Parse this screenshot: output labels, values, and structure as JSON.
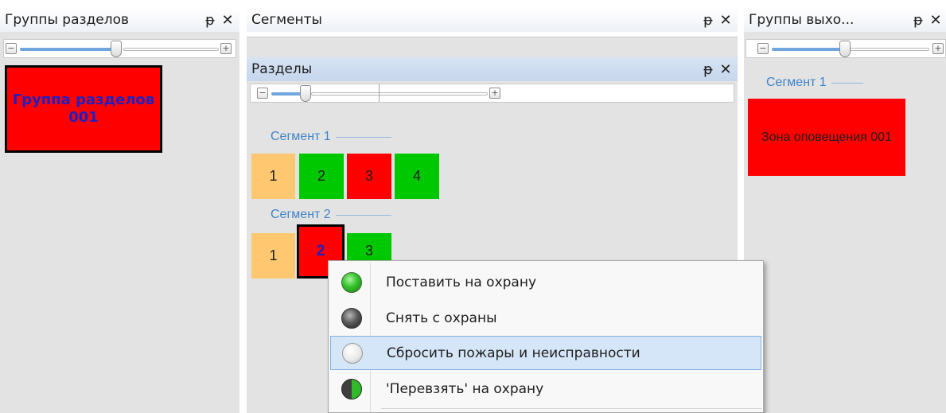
{
  "panels": {
    "left": {
      "title": "Группы разделов",
      "pin_icon": "pin-icon",
      "close_icon": "close-icon"
    },
    "segments": {
      "title": "Сегменты",
      "pin_icon": "pin-icon",
      "close_icon": "close-icon"
    },
    "sections": {
      "title": "Разделы",
      "pin_icon": "pin-icon",
      "close_icon": "close-icon"
    },
    "right": {
      "title": "Группы выхо...",
      "pin_icon": "pin-icon",
      "close_icon": "close-icon"
    }
  },
  "glyphs": {
    "pin": "ᵽ",
    "close": "✕",
    "minus": "−",
    "plus": "+"
  },
  "left_groups": [
    {
      "label": "Группа разделов 001",
      "color": "#ff0000"
    }
  ],
  "sections": {
    "segment1": {
      "label": "Сегмент 1",
      "tiles": [
        {
          "label": "1",
          "color": "#ffc870"
        },
        {
          "label": "2",
          "color": "#00c800"
        },
        {
          "label": "3",
          "color": "#ff0000"
        },
        {
          "label": "4",
          "color": "#00c800"
        }
      ]
    },
    "segment2": {
      "label": "Сегмент 2",
      "tiles": [
        {
          "label": "1",
          "color": "#ffc870"
        },
        {
          "label": "2",
          "color": "#ff0000",
          "selected": true
        },
        {
          "label": "3",
          "color": "#00c800"
        }
      ]
    }
  },
  "right_groups": {
    "segment_label": "Сегмент 1",
    "items": [
      {
        "label": "Зона оповещения 001",
        "color": "#ff0000"
      }
    ]
  },
  "context_menu": {
    "items": [
      {
        "label": "Поставить на охрану",
        "icon": "green-circle-icon",
        "highlighted": false
      },
      {
        "label": "Снять с охраны",
        "icon": "dark-circle-icon",
        "highlighted": false
      },
      {
        "label": "Сбросить пожары и неисправности",
        "icon": "white-circle-icon",
        "highlighted": true
      },
      {
        "label": "'Перевзять' на охрану",
        "icon": "half-green-circle-icon",
        "highlighted": false
      }
    ]
  }
}
